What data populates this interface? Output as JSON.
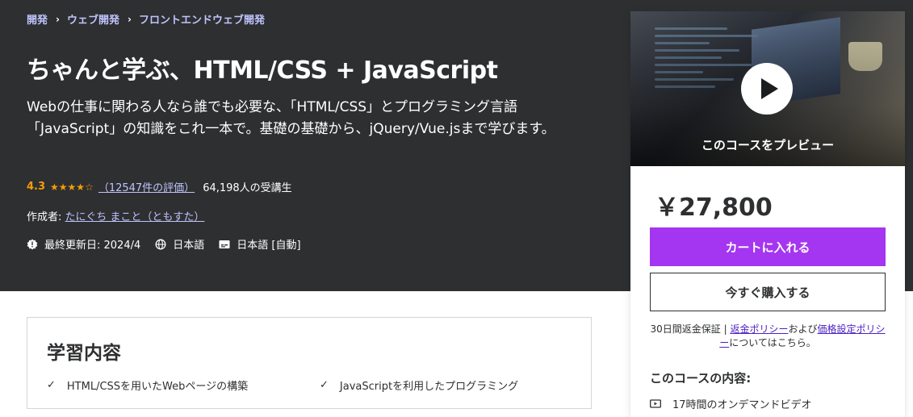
{
  "breadcrumb": [
    "開発",
    "ウェブ開発",
    "フロントエンドウェブ開発"
  ],
  "course": {
    "title": "ちゃんと学ぶ、HTML/CSS + JavaScript",
    "subtitle": "Webの仕事に関わる人なら誰でも必要な、「HTML/CSS」とプログラミング言語「JavaScript」の知識をこれ一本で。基礎の基礎から、jQuery/Vue.jsまで学びます。",
    "rating": "4.3",
    "rating_value": 4.3,
    "rating_count_link": "（12547件の評価）",
    "students": "64,198人の受講生",
    "author_label": "作成者:",
    "author": "たにぐち まこと（ともすた）",
    "last_updated": "最終更新日: 2024/4",
    "language": "日本語",
    "captions": "日本語 [自動]"
  },
  "learn": {
    "title": "学習内容",
    "items": [
      "HTML/CSSを用いたWebページの構築",
      "JavaScriptを利用したプログラミング"
    ]
  },
  "sidebar": {
    "preview_label": "このコースをプレビュー",
    "price": "￥27,800",
    "cart_button": "カートに入れる",
    "buy_button": "今すぐ購入する",
    "refund_prefix": "30日間返金保証 | ",
    "refund_link": "返金ポリシー",
    "refund_mid": "および",
    "pricing_link": "価格設定ポリシー",
    "refund_suffix": "についてはこちら。",
    "includes_title": "このコースの内容:",
    "includes": [
      "17時間のオンデマンドビデオ"
    ]
  },
  "colors": {
    "hero_bg": "#2d2f31",
    "link_purple": "#c0c4fc",
    "star": "#f69c08",
    "cta": "#a435f0"
  }
}
